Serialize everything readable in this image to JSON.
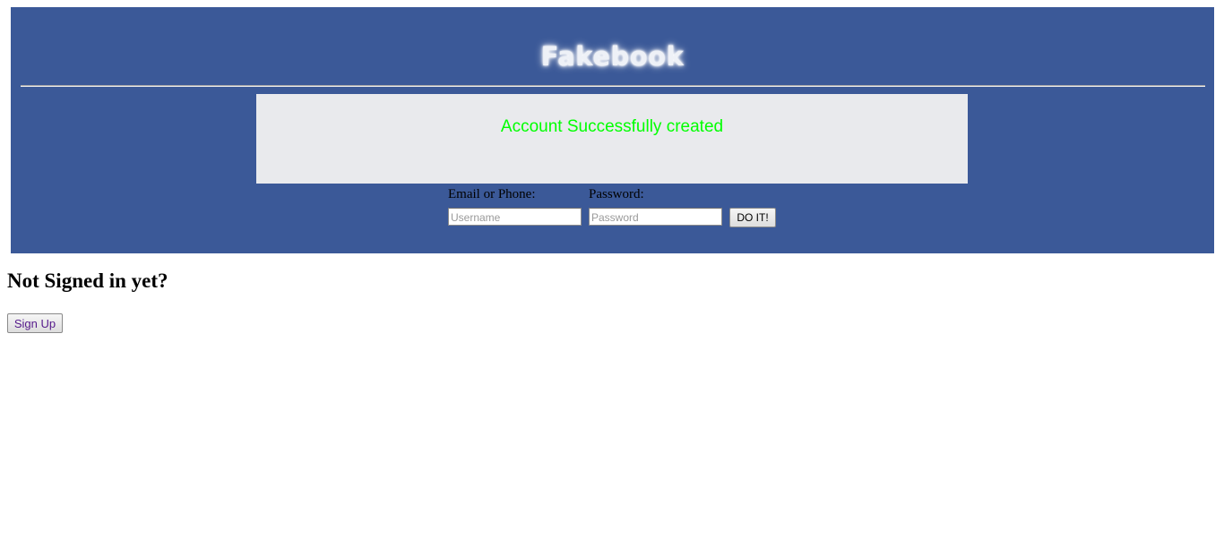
{
  "header": {
    "logo_text": "Fakebook"
  },
  "notice": {
    "message": "Account Successfully created",
    "color": "#00ff00"
  },
  "login": {
    "email_label": "Email or Phone:",
    "password_label": "Password:",
    "username_placeholder": "Username",
    "password_placeholder": "Password",
    "username_value": "",
    "password_value": "",
    "submit_label": "DO IT!"
  },
  "signup": {
    "heading": "Not Signed in yet?",
    "button_label": "Sign Up"
  },
  "colors": {
    "banner": "#3b5998",
    "notice_box": "#e9eaed",
    "link_text": "#551a8b"
  }
}
